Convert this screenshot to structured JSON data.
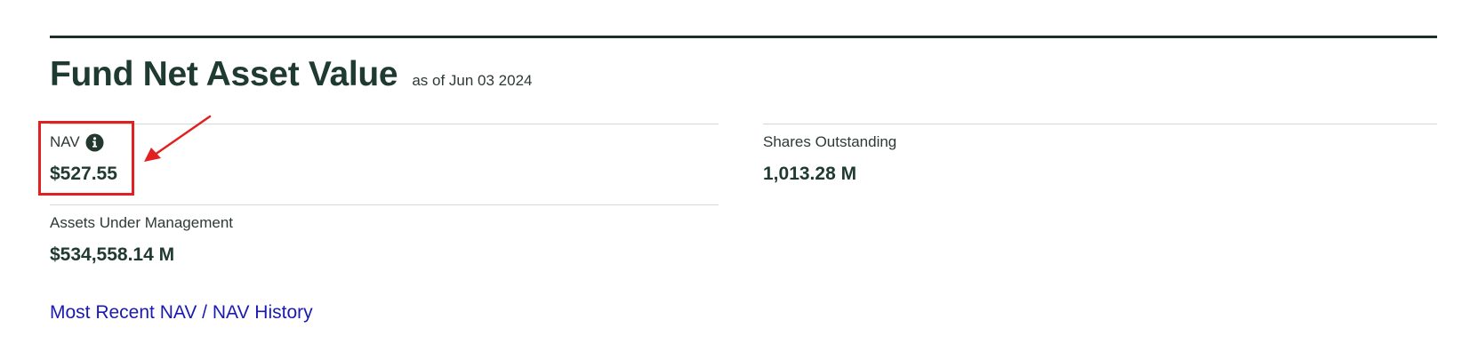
{
  "section": {
    "title": "Fund Net Asset Value",
    "as_of": "as of Jun 03 2024"
  },
  "stats": {
    "nav": {
      "label": "NAV",
      "value": "$527.55",
      "info_icon": "info-circle-icon"
    },
    "shares_outstanding": {
      "label": "Shares Outstanding",
      "value": "1,013.28 M"
    },
    "aum": {
      "label": "Assets Under Management",
      "value": "$534,558.14 M"
    }
  },
  "link": {
    "text": "Most Recent NAV / NAV History"
  },
  "annotation": {
    "color": "#e32020",
    "target": "nav"
  },
  "colors": {
    "heading": "#1f3a30",
    "link": "#1a1ab0",
    "rule": "#1e2f27",
    "divider": "#d6d6d6"
  }
}
